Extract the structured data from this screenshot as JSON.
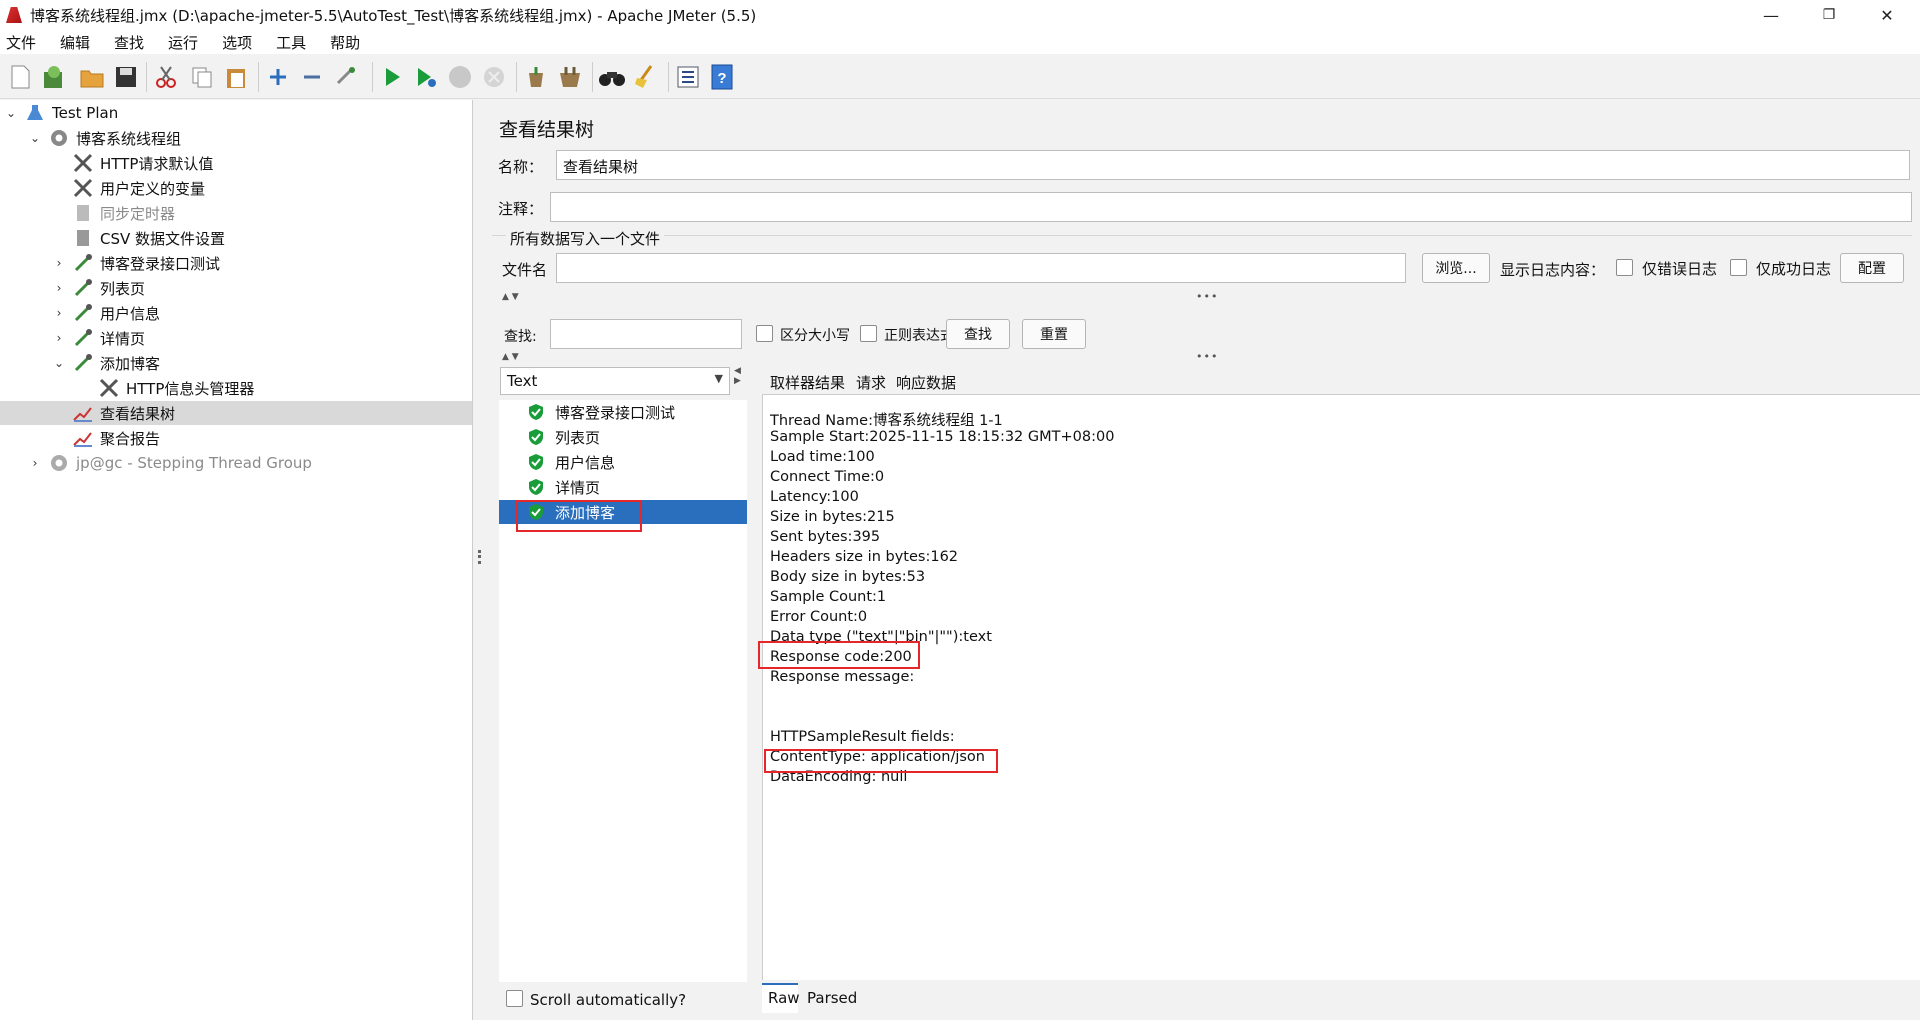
{
  "window": {
    "title": "博客系统线程组.jmx (D:\\apache-jmeter-5.5\\AutoTest_Test\\博客系统线程组.jmx) - Apache JMeter (5.5)",
    "minimize": "—",
    "restore": "❐",
    "close": "✕"
  },
  "menu": [
    "文件",
    "编辑",
    "查找",
    "运行",
    "选项",
    "工具",
    "帮助"
  ],
  "toolbar_icons": [
    "new-icon",
    "templates-icon",
    "open-icon",
    "save-icon",
    "cut-icon",
    "copy-icon",
    "paste-icon",
    "expand-icon",
    "collapse-icon",
    "toggle-icon",
    "start-icon",
    "start-no-pause-icon",
    "stop-icon",
    "shutdown-icon",
    "clear-icon",
    "clear-all-icon",
    "search-icon",
    "reset-search-icon",
    "function-helper-icon",
    "help-icon"
  ],
  "tree": {
    "items": [
      {
        "label": "Test Plan"
      },
      {
        "label": "博客系统线程组"
      },
      {
        "label": "HTTP请求默认值"
      },
      {
        "label": "用户定义的变量"
      },
      {
        "label": "同步定时器"
      },
      {
        "label": "CSV 数据文件设置"
      },
      {
        "label": "博客登录接口测试"
      },
      {
        "label": "列表页"
      },
      {
        "label": "用户信息"
      },
      {
        "label": "详情页"
      },
      {
        "label": "添加博客"
      },
      {
        "label": "HTTP信息头管理器"
      },
      {
        "label": "查看结果树"
      },
      {
        "label": "聚合报告"
      },
      {
        "label": "jp@gc - Stepping Thread Group"
      }
    ]
  },
  "panel": {
    "title": "查看结果树",
    "name_label": "名称：",
    "name_value": "查看结果树",
    "comment_label": "注释：",
    "comment_value": "",
    "file_section": "所有数据写入一个文件",
    "filename_label": "文件名",
    "filename_value": "",
    "browse": "浏览...",
    "log_label": "显示日志内容：",
    "errors_only": "仅错误日志",
    "success_only": "仅成功日志",
    "configure": "配置",
    "search_label": "查找:",
    "search_value": "",
    "case_sensitive": "区分大小写",
    "regex": "正则表达式",
    "find": "查找",
    "reset": "重置"
  },
  "renderer": {
    "selected": "Text"
  },
  "results": [
    {
      "label": "博客登录接口测试"
    },
    {
      "label": "列表页"
    },
    {
      "label": "用户信息"
    },
    {
      "label": "详情页"
    },
    {
      "label": "添加博客"
    }
  ],
  "scroll_auto": "Scroll automatically?",
  "tabs": [
    "取样器结果",
    "请求",
    "响应数据"
  ],
  "detail_lines": [
    "Thread Name:博客系统线程组 1-1",
    "Sample Start:2025-11-15 18:15:32 GMT+08:00",
    "Load time:100",
    "Connect Time:0",
    "Latency:100",
    "Size in bytes:215",
    "Sent bytes:395",
    "Headers size in bytes:162",
    "Body size in bytes:53",
    "Sample Count:1",
    "Error Count:0",
    "Data type (\"text\"|\"bin\"|\"\"):text",
    "Response code:200",
    "Response message:",
    "",
    "",
    "HTTPSampleResult fields:",
    "ContentType: application/json",
    "DataEncoding: null"
  ],
  "bottom_tabs": [
    "Raw",
    "Parsed"
  ],
  "colors": {
    "selection": "#2a6fbd",
    "highlight": "#e5262b",
    "success": "#1a9c3a"
  }
}
